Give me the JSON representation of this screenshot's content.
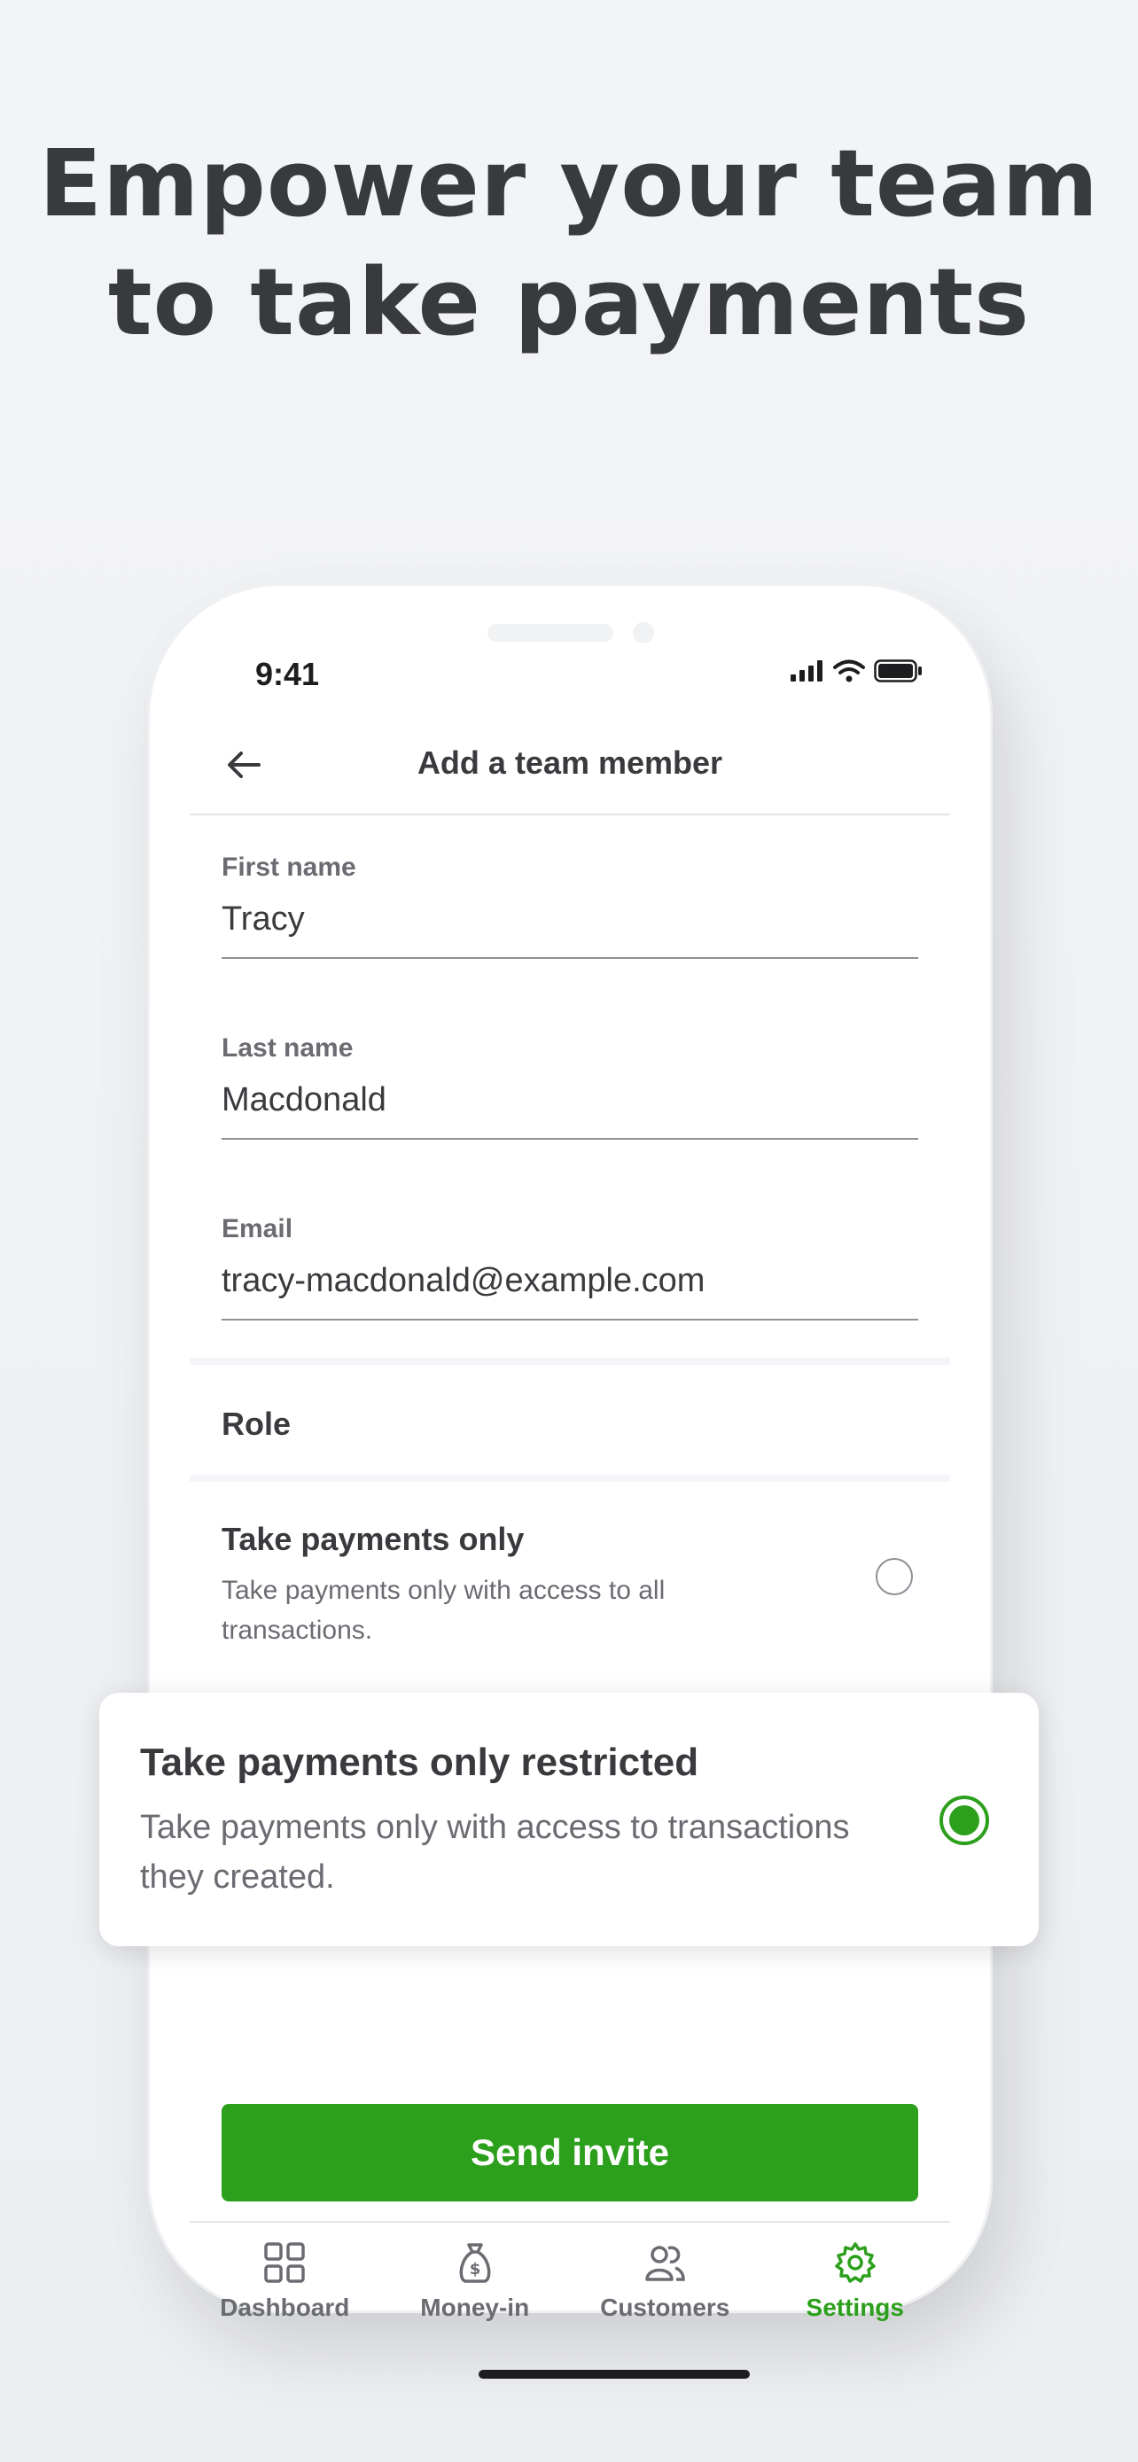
{
  "headline": {
    "line1": "Empower your team",
    "line2": "to take payments"
  },
  "status_bar": {
    "time": "9:41"
  },
  "nav": {
    "title": "Add a team member"
  },
  "form": {
    "first_name": {
      "label": "First name",
      "value": "Tracy"
    },
    "last_name": {
      "label": "Last name",
      "value": "Macdonald"
    },
    "email": {
      "label": "Email",
      "value": "tracy-macdonald@example.com"
    }
  },
  "role": {
    "label": "Role",
    "options": [
      {
        "title": "Take payments only",
        "description": "Take payments only with access to all transactions.",
        "selected": false
      },
      {
        "title": "Take payments only restricted",
        "description": "Take payments only with access to transactions they created.",
        "selected": true
      }
    ]
  },
  "actions": {
    "send_label": "Send invite"
  },
  "tabs": [
    {
      "label": "Dashboard",
      "icon": "dashboard-icon",
      "active": false
    },
    {
      "label": "Money-in",
      "icon": "money-bag-icon",
      "active": false
    },
    {
      "label": "Customers",
      "icon": "customers-icon",
      "active": false
    },
    {
      "label": "Settings",
      "icon": "gear-icon",
      "active": true
    }
  ],
  "colors": {
    "accent": "#2ca01c",
    "text": "#393a3d",
    "muted": "#6b6c72"
  }
}
